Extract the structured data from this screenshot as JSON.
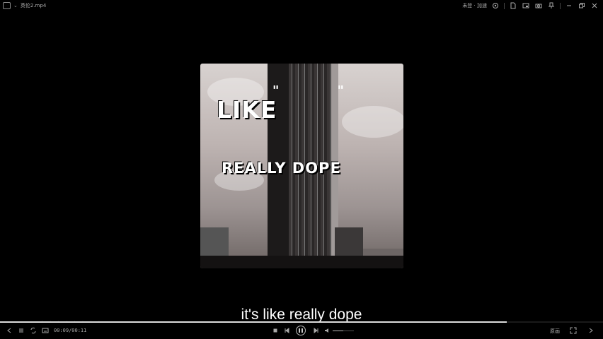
{
  "window": {
    "title": "英伦2.mp4",
    "right_status": "未登 · 加速"
  },
  "video": {
    "overlay_line1": "LIKE",
    "overlay_line2": "REALLY DOPE",
    "overlay_quotes": "\" \""
  },
  "subtitle": "it's like really dope",
  "player": {
    "time": "00:09/00:11",
    "progress_fraction": 0.84,
    "volume_fraction": 0.5,
    "quality_label": "原画",
    "timeline_dots": "• • • • • • • •"
  },
  "icons": {
    "app_logo": "app-logo-icon",
    "menu_caret": "chevron-down-icon",
    "file": "file-icon",
    "mini_player": "mini-player-icon",
    "capture": "screenshot-icon",
    "pin": "pin-icon",
    "minimize": "minimize-icon",
    "restore": "restore-icon",
    "close": "close-icon"
  }
}
